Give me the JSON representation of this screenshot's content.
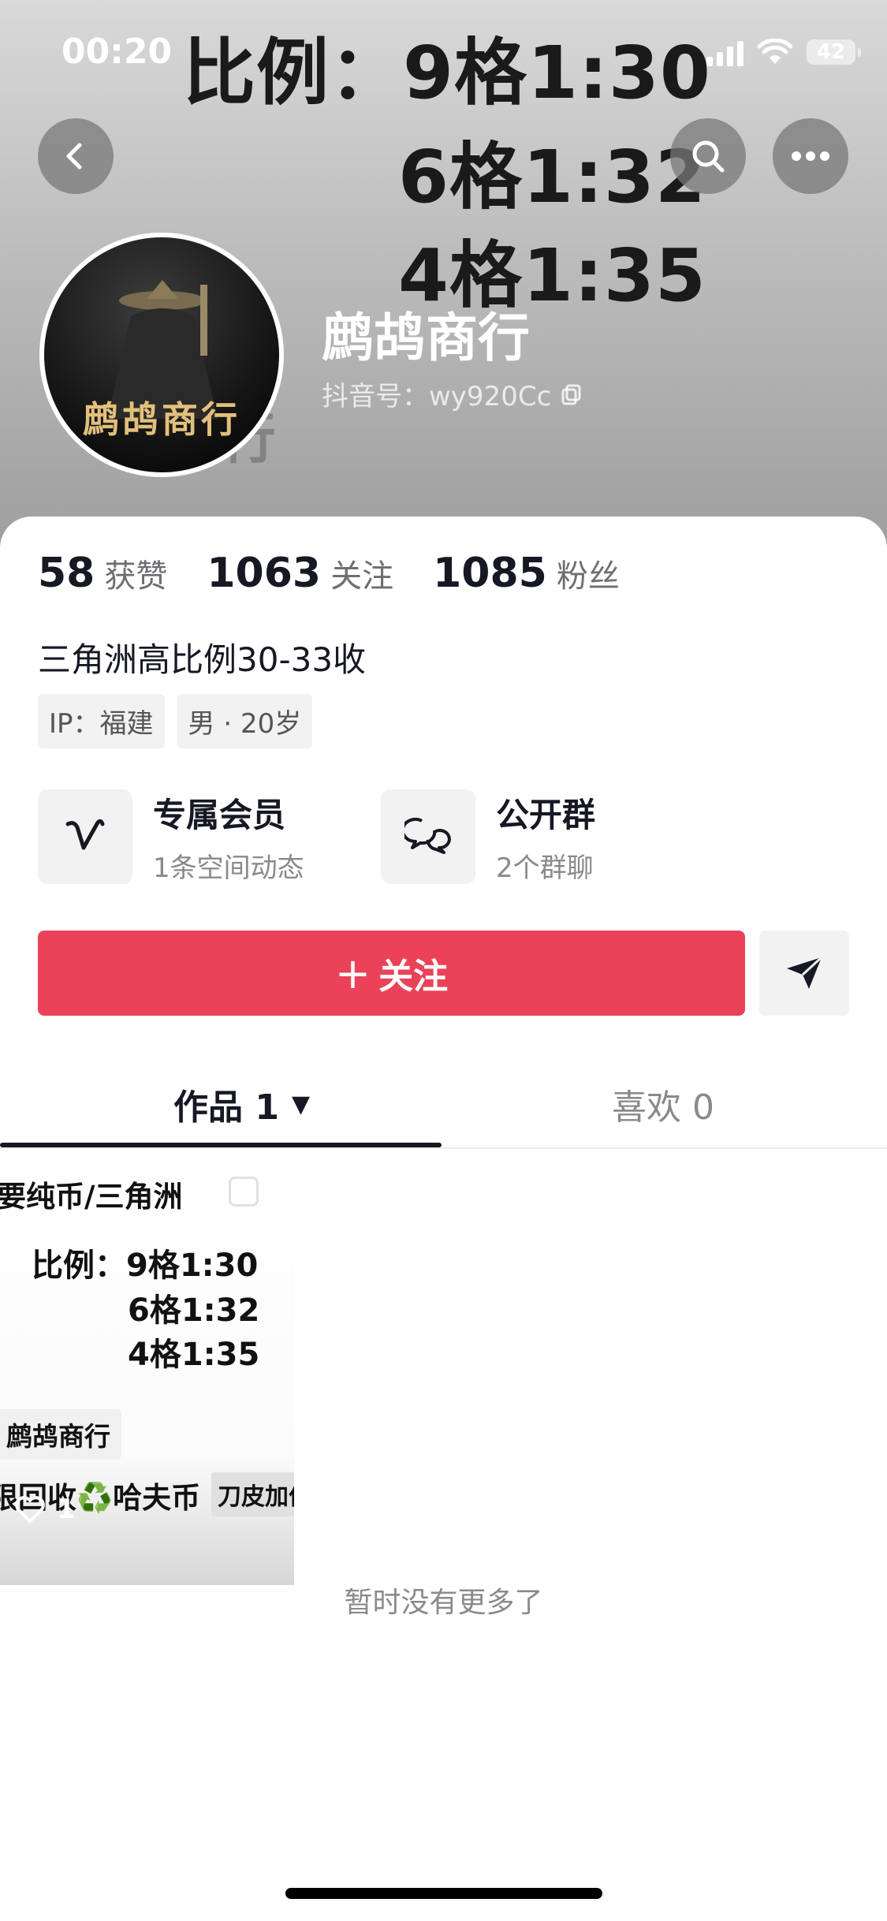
{
  "status_bar": {
    "time": "00:20",
    "battery": "42"
  },
  "banner": {
    "line1": "比例：9格1:30",
    "line2": "6格1:32",
    "line3": "4格1:35",
    "watermark": "行"
  },
  "profile": {
    "name": "鹧鸪商行",
    "avatar_text": "鹧鸪商行",
    "douyin_id": "抖音号：wy920Cc"
  },
  "stats": [
    {
      "value": "58",
      "label": "获赞"
    },
    {
      "value": "1063",
      "label": "关注"
    },
    {
      "value": "1085",
      "label": "粉丝"
    }
  ],
  "bio": "三角洲高比例30-33收",
  "tags": [
    "IP：福建",
    "男 · 20岁"
  ],
  "features": {
    "member": {
      "title": "专属会员",
      "subtitle": "1条空间动态"
    },
    "group": {
      "title": "公开群",
      "subtitle": "2个群聊"
    }
  },
  "actions": {
    "follow_plus": "+",
    "follow_label": "关注"
  },
  "tabs": {
    "works": "作品 1",
    "likes": "喜欢 0"
  },
  "video": {
    "top_text": "要纯币/三角洲",
    "ratio1": "比例：9格1:30",
    "ratio2": "6格1:32",
    "ratio3": "4格1:35",
    "brand": "鹧鸪商行",
    "bottom_text": "限回收♻️哈夫币",
    "bottom_tag": "刀皮加价",
    "likes": "1"
  },
  "footer": {
    "no_more": "暂时没有更多了"
  },
  "icons": {
    "back": "back-arrow-icon",
    "search": "search-icon",
    "more": "more-dots-icon",
    "copy": "copy-icon",
    "member": "vip-v-icon",
    "group": "chat-bubbles-icon",
    "share": "paper-plane-icon",
    "heart": "heart-icon"
  },
  "colors": {
    "follow": "#ea4359",
    "header_bg": "#bdbdbd",
    "text": "#161823"
  }
}
